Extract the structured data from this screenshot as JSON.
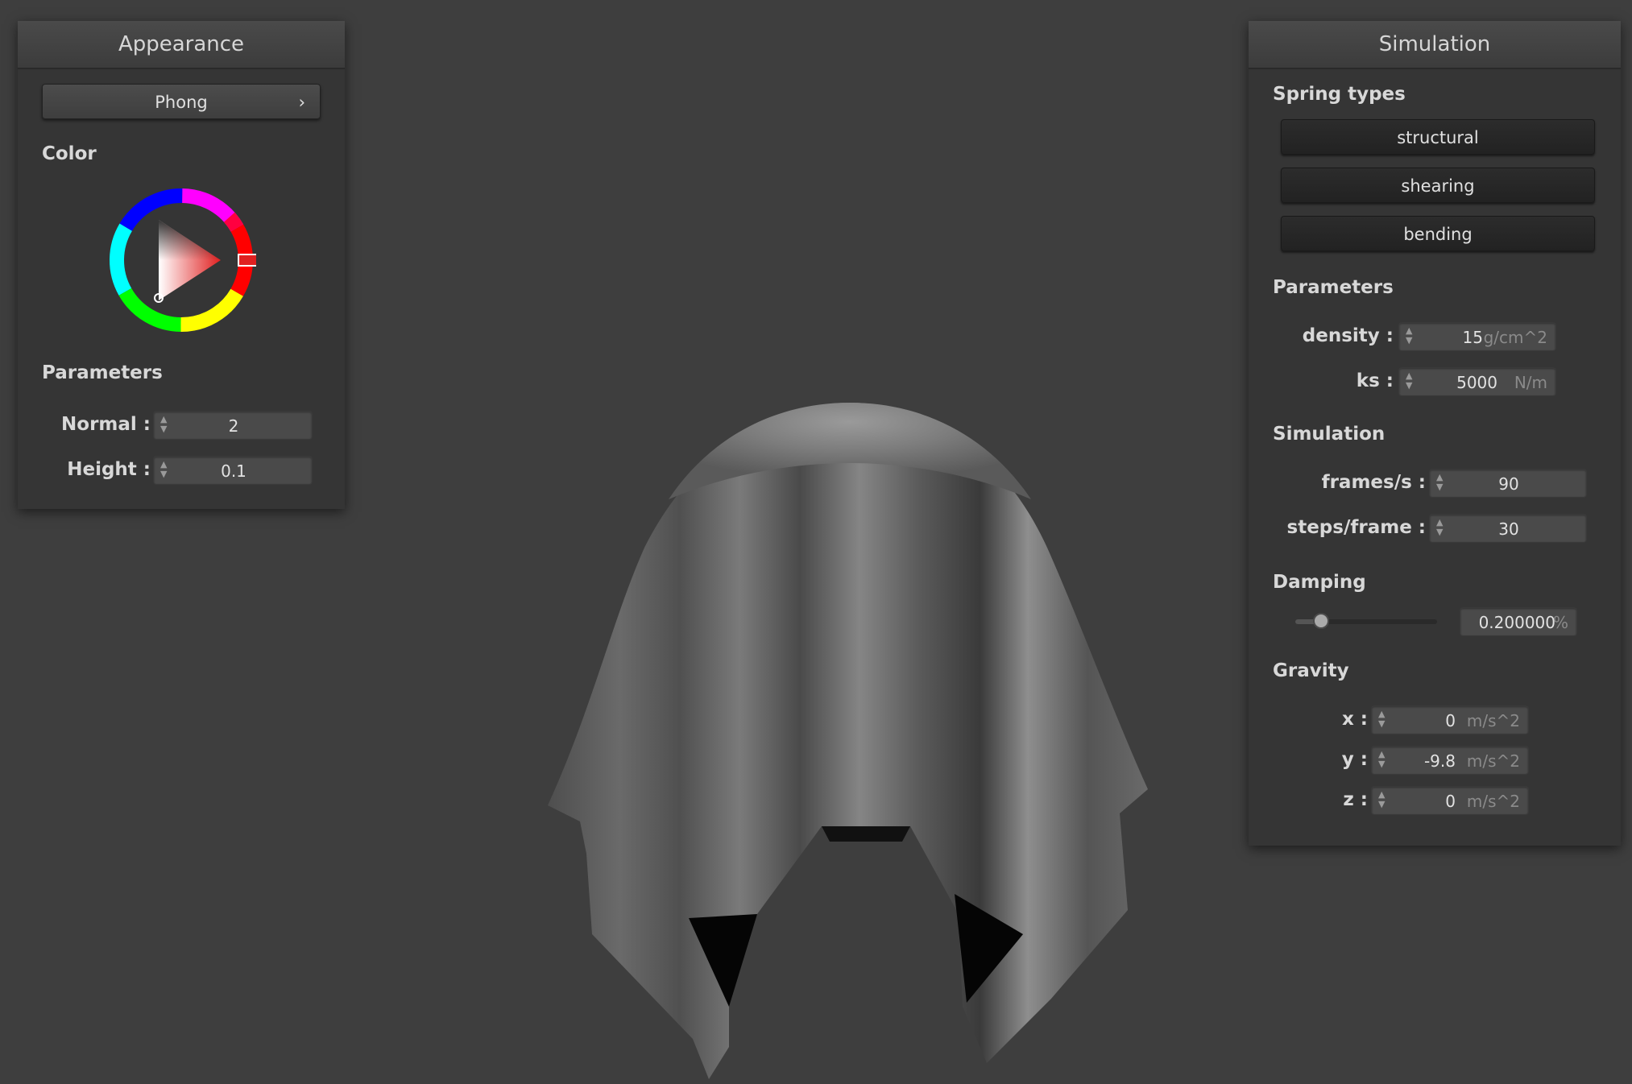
{
  "appearance": {
    "title": "Appearance",
    "shader_label": "Phong",
    "shader_chevron": "›",
    "color_label": "Color",
    "params_label": "Parameters",
    "normal_label": "Normal :",
    "normal_value": "2",
    "height_label": "Height :",
    "height_value": "0.1",
    "selected_color": "#e02020"
  },
  "simulation": {
    "title": "Simulation",
    "spring_types_label": "Spring types",
    "spring_types": [
      "structural",
      "shearing",
      "bending"
    ],
    "params_label": "Parameters",
    "density_label": "density :",
    "density_value": "15",
    "density_unit": "g/cm^2",
    "ks_label": "ks :",
    "ks_value": "5000",
    "ks_unit": "N/m",
    "sim_label": "Simulation",
    "fps_label": "frames/s :",
    "fps_value": "90",
    "steps_label": "steps/frame :",
    "steps_value": "30",
    "damping_label": "Damping",
    "damping_value": "0.200000",
    "damping_unit": "%",
    "damping_fraction": 0.2,
    "gravity_label": "Gravity",
    "gx_label": "x :",
    "gx_value": "0",
    "gy_label": "y :",
    "gy_value": "-9.8",
    "gz_label": "z :",
    "gz_value": "0",
    "gravity_unit": "m/s^2"
  }
}
